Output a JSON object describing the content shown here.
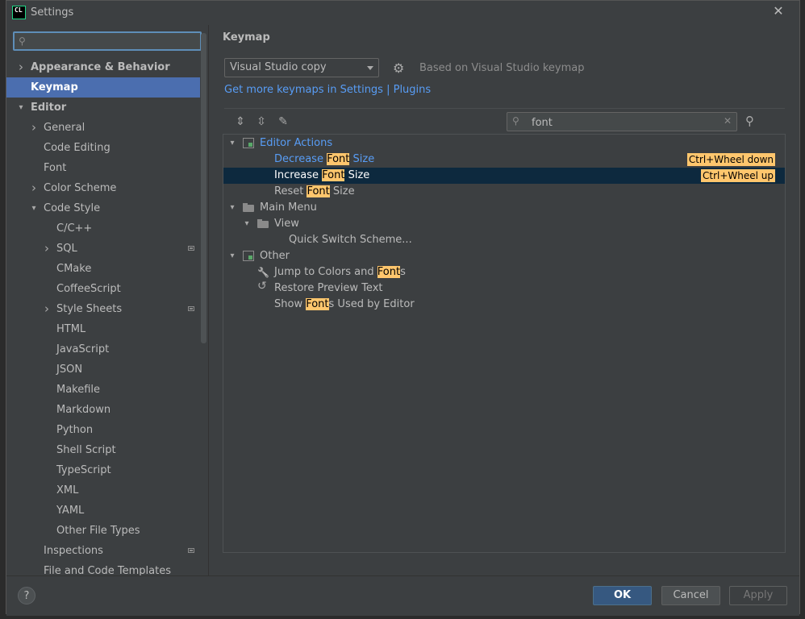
{
  "window": {
    "title": "Settings",
    "app_icon_text": "CL"
  },
  "search": {
    "placeholder": "",
    "value": ""
  },
  "tree": [
    {
      "label": "Appearance & Behavior",
      "indent": 0,
      "arrow": "right",
      "bold": true
    },
    {
      "label": "Keymap",
      "indent": 0,
      "arrow": "",
      "bold": true,
      "selected": true
    },
    {
      "label": "Editor",
      "indent": 0,
      "arrow": "down",
      "bold": true
    },
    {
      "label": "General",
      "indent": 1,
      "arrow": "right"
    },
    {
      "label": "Code Editing",
      "indent": 1,
      "arrow": ""
    },
    {
      "label": "Font",
      "indent": 1,
      "arrow": ""
    },
    {
      "label": "Color Scheme",
      "indent": 1,
      "arrow": "right"
    },
    {
      "label": "Code Style",
      "indent": 1,
      "arrow": "down"
    },
    {
      "label": "C/C++",
      "indent": 2,
      "arrow": ""
    },
    {
      "label": "SQL",
      "indent": 2,
      "arrow": "right",
      "mark": true
    },
    {
      "label": "CMake",
      "indent": 2,
      "arrow": ""
    },
    {
      "label": "CoffeeScript",
      "indent": 2,
      "arrow": ""
    },
    {
      "label": "Style Sheets",
      "indent": 2,
      "arrow": "right",
      "mark": true
    },
    {
      "label": "HTML",
      "indent": 2,
      "arrow": ""
    },
    {
      "label": "JavaScript",
      "indent": 2,
      "arrow": ""
    },
    {
      "label": "JSON",
      "indent": 2,
      "arrow": ""
    },
    {
      "label": "Makefile",
      "indent": 2,
      "arrow": ""
    },
    {
      "label": "Markdown",
      "indent": 2,
      "arrow": ""
    },
    {
      "label": "Python",
      "indent": 2,
      "arrow": ""
    },
    {
      "label": "Shell Script",
      "indent": 2,
      "arrow": ""
    },
    {
      "label": "TypeScript",
      "indent": 2,
      "arrow": ""
    },
    {
      "label": "XML",
      "indent": 2,
      "arrow": ""
    },
    {
      "label": "YAML",
      "indent": 2,
      "arrow": ""
    },
    {
      "label": "Other File Types",
      "indent": 2,
      "arrow": ""
    },
    {
      "label": "Inspections",
      "indent": 1,
      "arrow": "",
      "mark": true
    },
    {
      "label": "File and Code Templates",
      "indent": 1,
      "arrow": ""
    }
  ],
  "keymap": {
    "title": "Keymap",
    "scheme": "Visual Studio copy",
    "based_on": "Based on Visual Studio keymap",
    "link": "Get more keymaps in Settings | Plugins",
    "filter": "font"
  },
  "actions": [
    {
      "indent": 0,
      "arrow": "down",
      "icon": "group",
      "parts": [
        "Editor Actions"
      ],
      "blue": true
    },
    {
      "indent": 1,
      "arrow": "",
      "icon": "",
      "parts": [
        "Decrease ",
        "Font",
        " Size"
      ],
      "blue": true,
      "shortcut": "Ctrl+Wheel down"
    },
    {
      "indent": 1,
      "arrow": "",
      "icon": "",
      "parts": [
        "Increase ",
        "Font",
        " Size"
      ],
      "selected": true,
      "shortcut": "Ctrl+Wheel up"
    },
    {
      "indent": 1,
      "arrow": "",
      "icon": "",
      "parts": [
        "Reset ",
        "Font",
        " Size"
      ]
    },
    {
      "indent": 0,
      "arrow": "down",
      "icon": "menu",
      "parts": [
        "Main Menu"
      ]
    },
    {
      "indent": 1,
      "arrow": "down",
      "icon": "folder",
      "parts": [
        "View"
      ]
    },
    {
      "indent": 2,
      "arrow": "",
      "icon": "",
      "parts": [
        "Quick Switch Scheme..."
      ]
    },
    {
      "indent": 0,
      "arrow": "down",
      "icon": "group",
      "parts": [
        "Other"
      ]
    },
    {
      "indent": 1,
      "arrow": "",
      "icon": "wrench",
      "parts": [
        "Jump to Colors and ",
        "Font",
        "s"
      ]
    },
    {
      "indent": 1,
      "arrow": "",
      "icon": "undo",
      "parts": [
        "Restore Preview Text"
      ]
    },
    {
      "indent": 1,
      "arrow": "",
      "icon": "",
      "parts": [
        "Show ",
        "Font",
        "s Used by Editor"
      ]
    }
  ],
  "buttons": {
    "ok": "OK",
    "cancel": "Cancel",
    "apply": "Apply",
    "help": "?"
  },
  "colors": {
    "selection": "#4b6eaf",
    "highlight": "#ffc66d",
    "link": "#589df6"
  }
}
